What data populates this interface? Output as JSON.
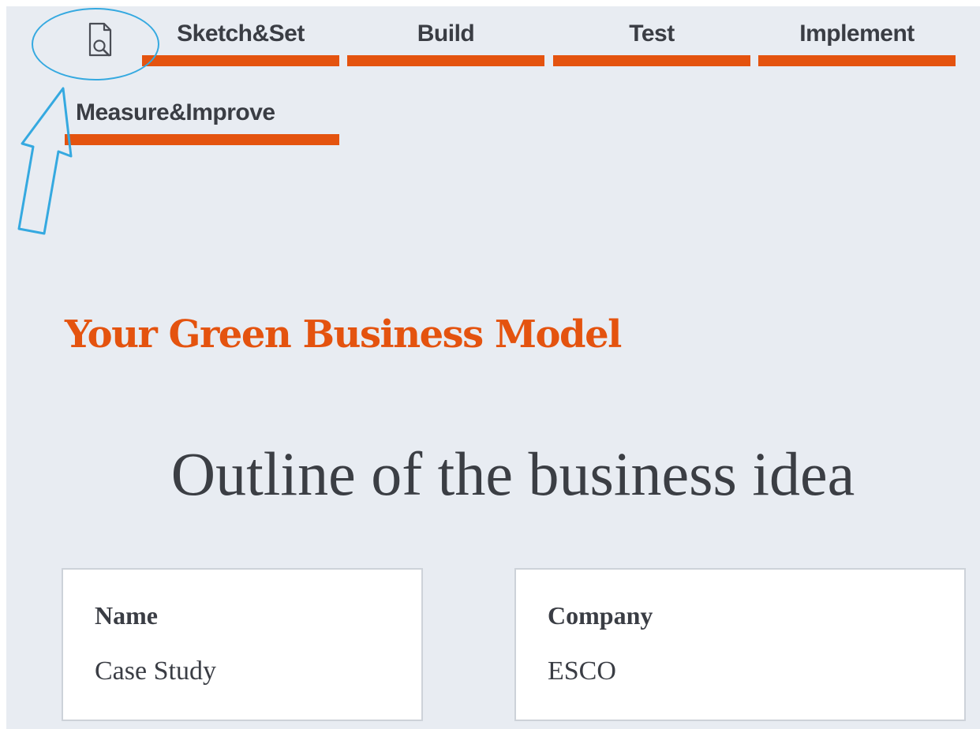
{
  "nav": {
    "items": [
      {
        "label": "Sketch&Set"
      },
      {
        "label": "Build"
      },
      {
        "label": "Test"
      },
      {
        "label": "Implement"
      },
      {
        "label": "Measure&Improve"
      }
    ],
    "icon": "document-search-icon"
  },
  "annotation": {
    "shapes": [
      "ellipse-highlight",
      "arrow-pointer"
    ],
    "color": "#35a9e0"
  },
  "page": {
    "section_title": "Your Green Business Model",
    "heading": "Outline of the business idea"
  },
  "cards": [
    {
      "label": "Name",
      "value": "Case Study"
    },
    {
      "label": "Company",
      "value": "ESCO"
    }
  ],
  "colors": {
    "accent": "#e4530f",
    "background": "#e8ecf2",
    "text": "#3a3d44",
    "card_border": "#cdd2d9"
  }
}
